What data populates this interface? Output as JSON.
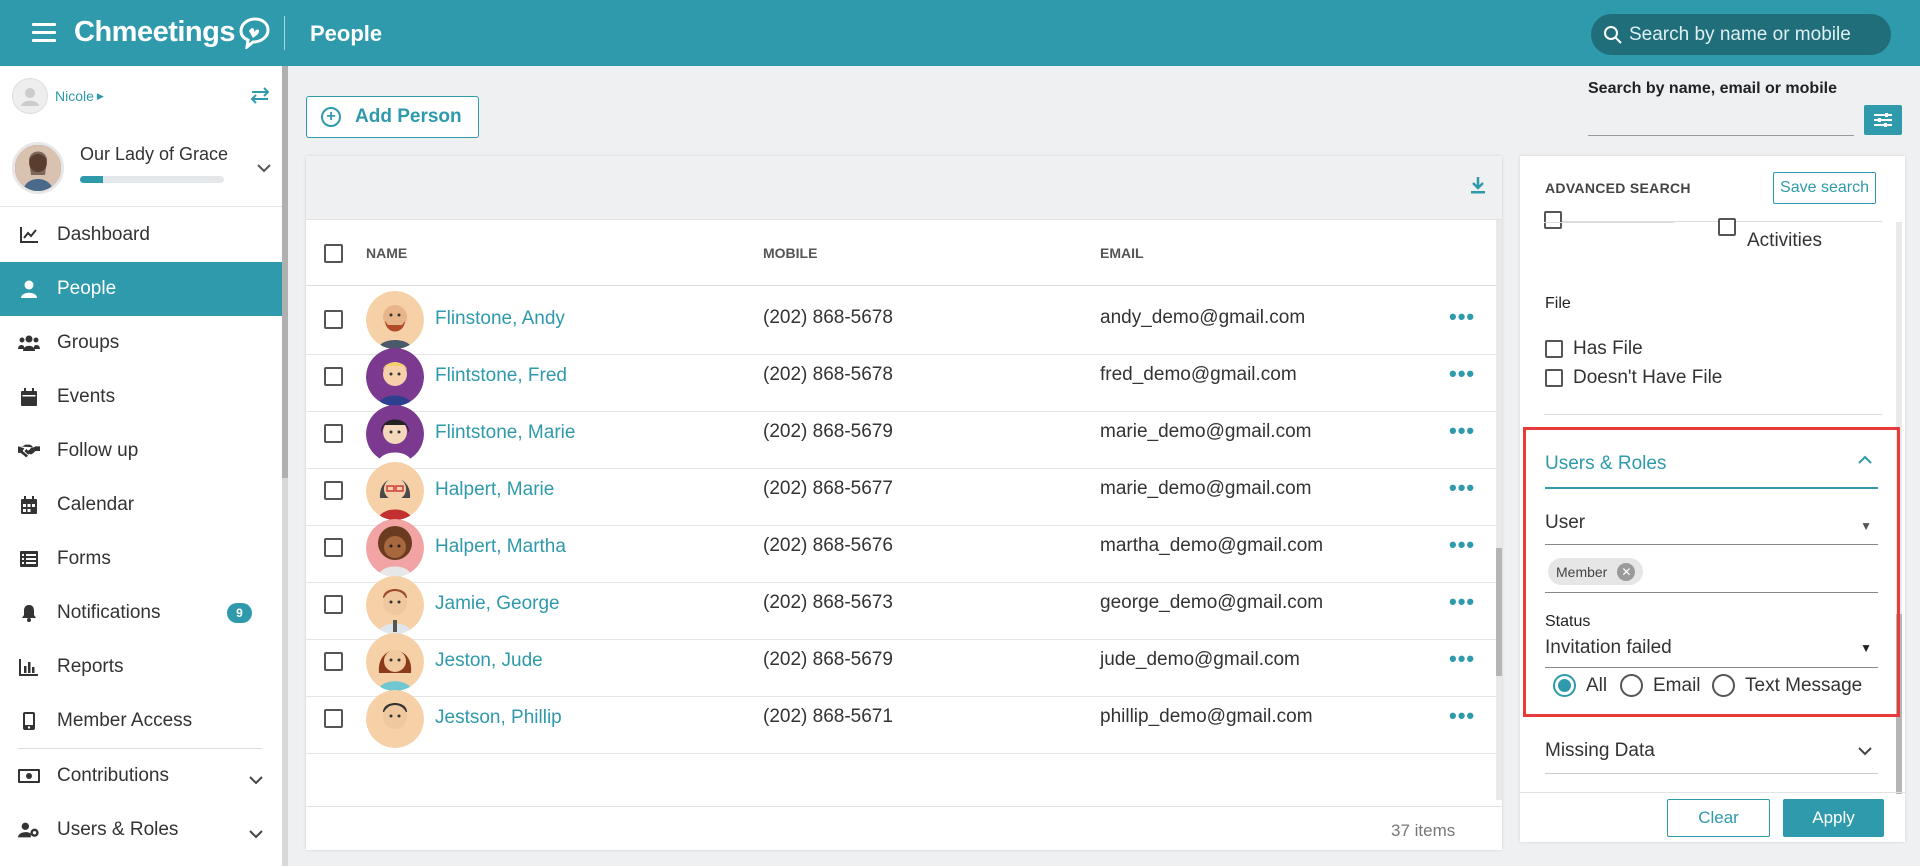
{
  "header": {
    "logo_text": "Chmeetings",
    "page_title": "People",
    "search_placeholder": "Search by name or mobile"
  },
  "sidebar": {
    "user_name": "Nicole",
    "church_name": "Our Lady of Grace",
    "church_progress_percent": 16,
    "items": [
      {
        "label": "Dashboard",
        "icon": "chart-line-icon",
        "active": false
      },
      {
        "label": "People",
        "icon": "person-icon",
        "active": true
      },
      {
        "label": "Groups",
        "icon": "users-icon",
        "active": false
      },
      {
        "label": "Events",
        "icon": "calendar-icon",
        "active": false
      },
      {
        "label": "Follow up",
        "icon": "handshake-icon",
        "active": false
      },
      {
        "label": "Calendar",
        "icon": "calendar-grid-icon",
        "active": false
      },
      {
        "label": "Forms",
        "icon": "list-icon",
        "active": false
      },
      {
        "label": "Notifications",
        "icon": "bell-icon",
        "active": false,
        "badge": "9"
      },
      {
        "label": "Reports",
        "icon": "bar-chart-icon",
        "active": false
      },
      {
        "label": "Member Access",
        "icon": "mobile-icon",
        "active": false
      },
      {
        "label": "Contributions",
        "icon": "money-icon",
        "active": false
      },
      {
        "label": "Users & Roles",
        "icon": "users-cog-icon",
        "active": false
      }
    ]
  },
  "main": {
    "add_person_label": "Add Person",
    "columns": {
      "name": "NAME",
      "mobile": "MOBILE",
      "email": "EMAIL"
    },
    "rows": [
      {
        "name": "Flinstone, Andy",
        "mobile": "(202) 868-5678",
        "email": "andy_demo@gmail.com",
        "avatar_bg": "#f4c9a0"
      },
      {
        "name": "Flintstone, Fred",
        "mobile": "(202) 868-5678",
        "email": "fred_demo@gmail.com",
        "avatar_bg": "#7b3a8f"
      },
      {
        "name": "Flintstone, Marie",
        "mobile": "(202) 868-5679",
        "email": "marie_demo@gmail.com",
        "avatar_bg": "#7b3a8f"
      },
      {
        "name": "Halpert, Marie",
        "mobile": "(202) 868-5677",
        "email": "marie_demo@gmail.com",
        "avatar_bg": "#f4c9a0"
      },
      {
        "name": "Halpert, Martha",
        "mobile": "(202) 868-5676",
        "email": "martha_demo@gmail.com",
        "avatar_bg": "#f2a3a3"
      },
      {
        "name": "Jamie, George",
        "mobile": "(202) 868-5673",
        "email": "george_demo@gmail.com",
        "avatar_bg": "#f4c9a0"
      },
      {
        "name": "Jeston, Jude",
        "mobile": "(202) 868-5679",
        "email": "jude_demo@gmail.com",
        "avatar_bg": "#f4c9a0"
      },
      {
        "name": "Jestson, Phillip",
        "mobile": "(202) 868-5671",
        "email": "phillip_demo@gmail.com",
        "avatar_bg": "#f4c9a0"
      }
    ],
    "items_count": "37 items"
  },
  "search_panel": {
    "quick_label": "Search by name, email or mobile",
    "advanced_title": "ADVANCED SEARCH",
    "save_search_label": "Save search",
    "activities_label": "Activities",
    "file_label": "File",
    "has_file_label": "Has File",
    "no_file_label": "Doesn't Have File",
    "roles_section_title": "Users & Roles",
    "user_select_value": "User",
    "chip_label": "Member",
    "status_label": "Status",
    "status_value": "Invitation failed",
    "radio_all": "All",
    "radio_email": "Email",
    "radio_text": "Text Message",
    "selected_radio": "All",
    "missing_data_title": "Missing Data",
    "clear_label": "Clear",
    "apply_label": "Apply"
  },
  "colors": {
    "accent": "#2e9aab",
    "highlight_border": "#e8393b"
  }
}
